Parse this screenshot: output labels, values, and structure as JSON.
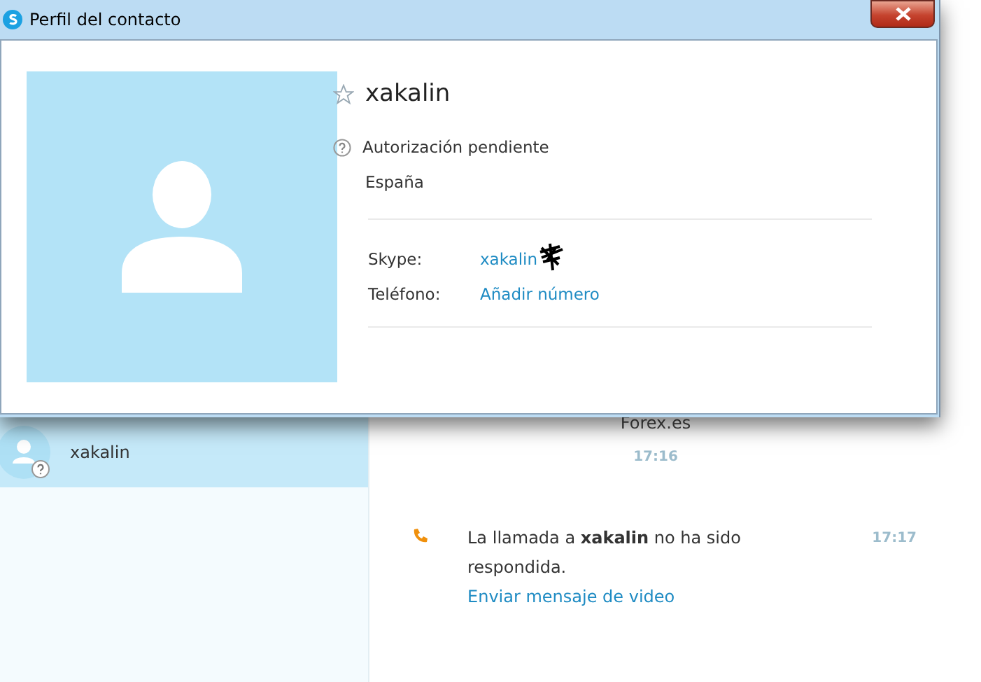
{
  "dialog": {
    "title": "Perfil del contacto",
    "profile": {
      "name": "xakalin",
      "favorite": false,
      "status": "Autorización pendiente",
      "location": "España"
    },
    "fields": [
      {
        "label": "Skype:",
        "value": "xakalin",
        "redacted": true
      },
      {
        "label": "Teléfono:",
        "value": "Añadir número",
        "redacted": false
      }
    ]
  },
  "contacts": [
    {
      "name": "xakalin",
      "selected": true
    }
  ],
  "chat": {
    "header": "Forex.es",
    "time": "17:16",
    "messages": [
      {
        "text": "La llamada a **xakalin** no ha sido respondida.",
        "link": "Enviar mensaje de video",
        "time": "17:17"
      }
    ]
  }
}
